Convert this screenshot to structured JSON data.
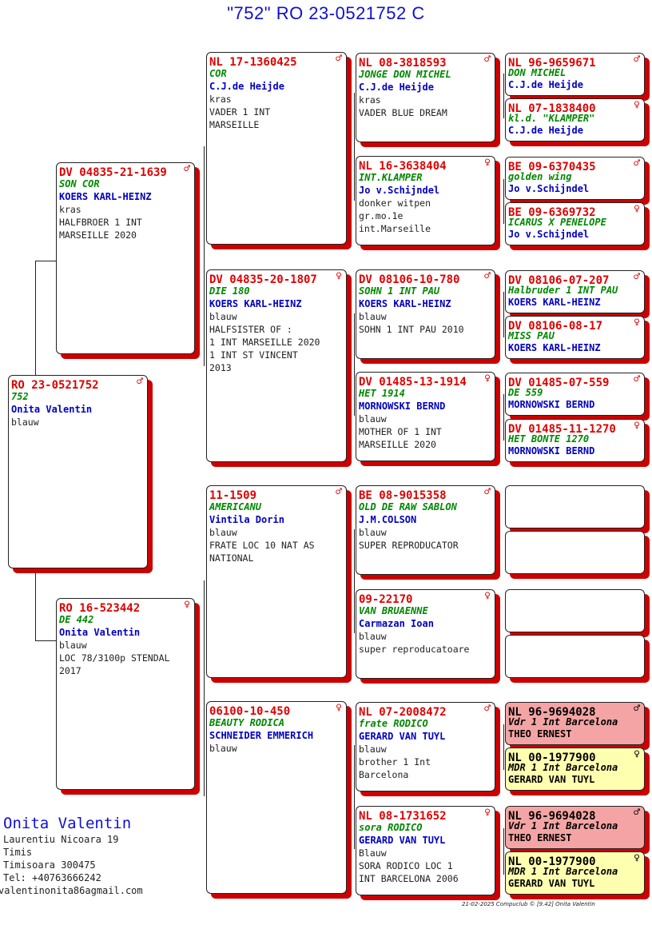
{
  "title": "\"752\"  RO  23-0521752 C",
  "birds": {
    "subject": {
      "ring": "RO  23-0521752",
      "sex": "♂",
      "name": "752",
      "owner": "Onita Valentin",
      "info": "blauw"
    },
    "sire": {
      "ring": "DV  04835-21-1639",
      "sex": "♂",
      "name": "SON COR",
      "owner": "KOERS KARL-HEINZ",
      "info": "kras\nHALFBROER 1 INT\nMARSEILLE 2020"
    },
    "dam": {
      "ring": "RO  16-523442",
      "sex": "♀",
      "name": "DE 442",
      "owner": "Onita Valentin",
      "info": "blauw\nLOC 78/3100p STENDAL\n2017"
    },
    "ss": {
      "ring": "NL  17-1360425",
      "sex": "♂",
      "name": "COR",
      "owner": "C.J.de Heijde",
      "info": "kras\nVADER 1 INT\nMARSEILLE"
    },
    "sd": {
      "ring": "DV  04835-20-1807",
      "sex": "♀",
      "name": "DIE 180",
      "owner": "KOERS KARL-HEINZ",
      "info": "blauw\nHALFSISTER OF :\n1 INT MARSEILLE 2020\n1 INT ST VINCENT\n2013"
    },
    "ds": {
      "ring": "     11-1509",
      "sex": "♂",
      "name": "AMERICANU",
      "owner": "Vintila Dorin",
      "info": "blauw\nFRATE LOC 10 NAT AS\nNATIONAL"
    },
    "dd": {
      "ring": "     06100-10-450",
      "sex": "♀",
      "name": "BEAUTY RODICA",
      "owner": "SCHNEIDER EMMERICH",
      "info": "blauw"
    },
    "sss": {
      "ring": "NL  08-3818593",
      "sex": "♂",
      "name": "JONGE DON MICHEL",
      "owner": "C.J.de Heijde",
      "info": "kras\nVADER BLUE DREAM"
    },
    "ssd": {
      "ring": "NL  16-3638404",
      "sex": "♀",
      "name": "INT.KLAMPER",
      "owner": "Jo v.Schijndel",
      "info": "donker witpen\ngr.mo.1e\nint.Marseille"
    },
    "sds": {
      "ring": "DV  08106-10-780",
      "sex": "♂",
      "name": "SOHN 1 INT PAU",
      "owner": "KOERS KARL-HEINZ",
      "info": "blauw\nSOHN 1 INT PAU 2010"
    },
    "sdd": {
      "ring": "DV  01485-13-1914",
      "sex": "♀",
      "name": "HET 1914",
      "owner": "MORNOWSKI BERND",
      "info": "blauw\nMOTHER OF 1 INT\nMARSEILLE 2020"
    },
    "dss": {
      "ring": "BE  08-9015358",
      "sex": "♂",
      "name": "OLD DE RAW SABLON",
      "owner": "J.M.COLSON",
      "info": "blauw\nSUPER REPRODUCATOR"
    },
    "dsd": {
      "ring": "     09-22170",
      "sex": "♀",
      "name": "VAN BRUAENNE",
      "owner": "Carmazan Ioan",
      "info": "blauw\nsuper reproducatoare"
    },
    "dds": {
      "ring": "NL  07-2008472",
      "sex": "♂",
      "name": "frate RODICO",
      "owner": "GERARD VAN TUYL",
      "info": "blauw\nbrother 1 Int\nBarcelona"
    },
    "ddd": {
      "ring": "NL  08-1731652",
      "sex": "♀",
      "name": "sora RODICO",
      "owner": "GERARD VAN TUYL",
      "info": "Blauw\nSORA RODICO LOC 1\nINT BARCELONA 2006"
    },
    "g1": {
      "ring": "NL  96-9659671",
      "sex": "♂",
      "name": "DON MICHEL",
      "owner": "C.J.de Heijde"
    },
    "g2": {
      "ring": "NL  07-1838400",
      "sex": "♀",
      "name": "kl.d. \"KLAMPER\"",
      "owner": "C.J.de Heijde"
    },
    "g3": {
      "ring": "BE  09-6370435",
      "sex": "♂",
      "name": "golden wing",
      "owner": "Jo v.Schijndel"
    },
    "g4": {
      "ring": "BE  09-6369732",
      "sex": "♀",
      "name": "ICARUS X PENELOPE",
      "owner": "Jo v.Schijndel"
    },
    "g5": {
      "ring": "DV  08106-07-207",
      "sex": "♂",
      "name": "Halbruder 1 INT PAU",
      "owner": "KOERS KARL-HEINZ"
    },
    "g6": {
      "ring": "DV  08106-08-17",
      "sex": "♀",
      "name": "MISS PAU",
      "owner": "KOERS KARL-HEINZ"
    },
    "g7": {
      "ring": "DV  01485-07-559",
      "sex": "♂",
      "name": "DE 559",
      "owner": "MORNOWSKI BERND"
    },
    "g8": {
      "ring": "DV  01485-11-1270",
      "sex": "♀",
      "name": "HET BONTE 1270",
      "owner": "MORNOWSKI BERND"
    },
    "g13": {
      "ring": "NL  96-9694028",
      "sex": "♂",
      "name": "Vdr 1 Int Barcelona",
      "owner": "THEO ERNEST"
    },
    "g14": {
      "ring": "NL  00-1977900",
      "sex": "♀",
      "name": "MDR 1 Int Barcelona",
      "owner": "GERARD VAN TUYL"
    },
    "g15": {
      "ring": "NL  96-9694028",
      "sex": "♂",
      "name": "Vdr 1 Int Barcelona",
      "owner": "THEO ERNEST"
    },
    "g16": {
      "ring": "NL  00-1977900",
      "sex": "♀",
      "name": "MDR 1 Int Barcelona",
      "owner": "GERARD VAN TUYL"
    }
  },
  "breeder": {
    "name": "Onita Valentin",
    "street": "Laurentiu Nicoara 19",
    "region": "Timis",
    "city": "Timisoara 300475",
    "tel": "Tel: +40763666242",
    "email": "valentinonita86agmail.com"
  },
  "footer": "21-02-2025   Compuclub © [9.42]   Onita Valentin",
  "colors": {
    "ring": "#e00000",
    "name": "#008800",
    "owner": "#0000c0",
    "title": "#1010d0",
    "shadow": "#cc0000",
    "box_red": "#f4a4a4",
    "box_yellow": "#ffffb0"
  }
}
